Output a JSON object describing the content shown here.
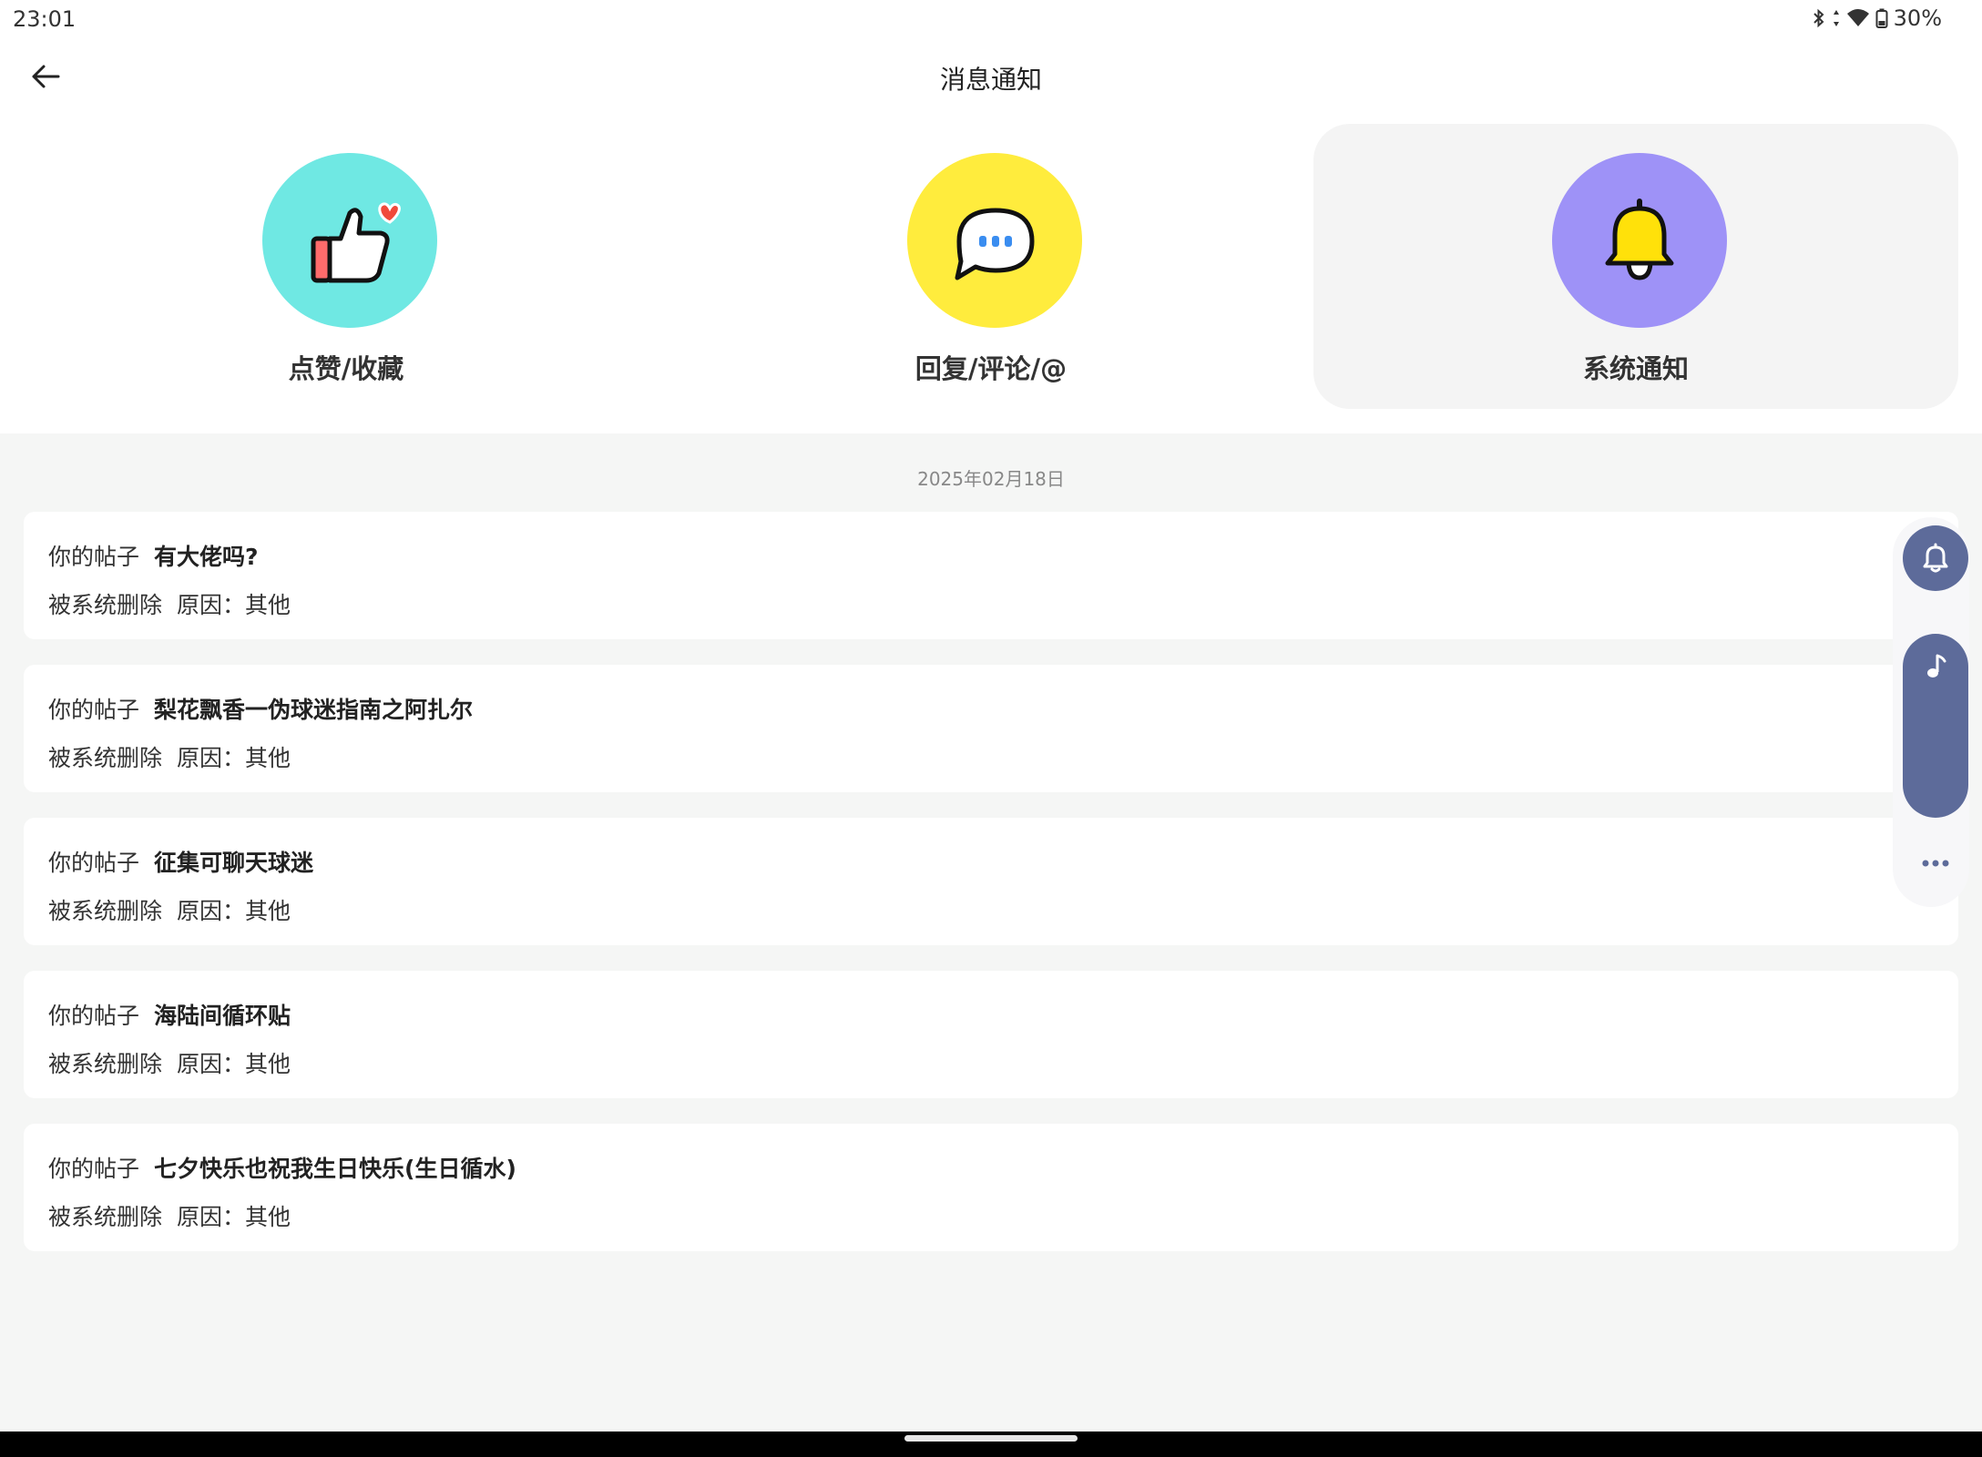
{
  "status_bar": {
    "time": "23:01",
    "battery": "30%"
  },
  "header": {
    "title": "消息通知"
  },
  "categories": [
    {
      "label": "点赞/收藏",
      "color": "#6fe8e3",
      "icon": "thumbs-up-icon"
    },
    {
      "label": "回复/评论/@",
      "color": "#ffec3d",
      "icon": "chat-bubble-icon"
    },
    {
      "label": "系统通知",
      "color": "#9e92f7",
      "icon": "bell-icon",
      "selected": true
    }
  ],
  "date": "2025年02月18日",
  "messages": [
    {
      "prefix": "你的帖子",
      "title": "有大佬吗?",
      "status": "被系统删除",
      "reason": "原因：其他"
    },
    {
      "prefix": "你的帖子",
      "title": "梨花飘香一伪球迷指南之阿扎尔",
      "status": "被系统删除",
      "reason": "原因：其他"
    },
    {
      "prefix": "你的帖子",
      "title": "征集可聊天球迷",
      "status": "被系统删除",
      "reason": "原因：其他"
    },
    {
      "prefix": "你的帖子",
      "title": "海陆间循环贴",
      "status": "被系统删除",
      "reason": "原因：其他"
    },
    {
      "prefix": "你的帖子",
      "title": "七夕快乐也祝我生日快乐(生日循水)",
      "status": "被系统删除",
      "reason": "原因：其他"
    }
  ],
  "floating_toolbar": {
    "accent": "#5d6b9a",
    "icons": [
      "bell-icon",
      "music-note-icon",
      "more-icon"
    ]
  }
}
